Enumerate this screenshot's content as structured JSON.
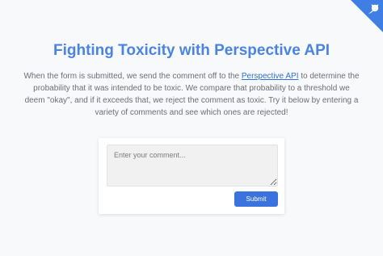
{
  "header": {
    "title": "Fighting Toxicity with Perspective API",
    "corner_icon": "github-octocat-icon",
    "accent_color": "#4a84e0"
  },
  "intro": {
    "text_before_link": "When the form is submitted, we send the comment off to the ",
    "link_text": "Perspective API",
    "text_after_link": " to determine the probability that it was intended to be toxic. We compare that probability to a threshold we deem \"okay\", and if it exceeds that, we reject the comment as toxic. Try it below by entering a variety of comments and see which ones are rejected!"
  },
  "form": {
    "comment_value": "",
    "comment_placeholder": "Enter your comment...",
    "submit_label": "Submit",
    "button_color": "#3b73de"
  }
}
